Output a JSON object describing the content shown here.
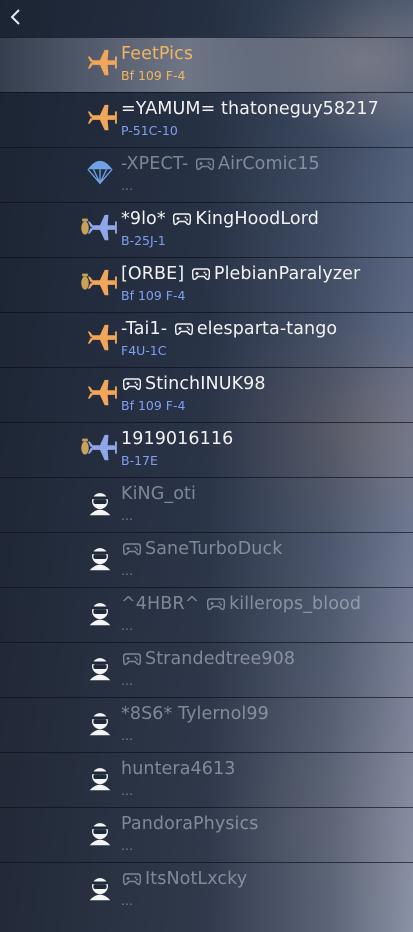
{
  "header": {
    "back_icon": "chevron-left-icon"
  },
  "colors": {
    "ally_plane": "#f2a65a",
    "bomber_plane": "#8fa6e8",
    "selected_text": "#f3b560",
    "vehicle_text": "#7fa0ee"
  },
  "players": [
    {
      "name": "FeetPics",
      "vehicle": "Bf 109 F-4",
      "icon": "fighter-plane-icon",
      "controller": false,
      "state": "selected"
    },
    {
      "name": "=YAMUM= thatoneguy58217",
      "vehicle": "P-51C-10",
      "icon": "fighter-plane-icon",
      "controller": false,
      "state": "active"
    },
    {
      "name": "-XPECT- ",
      "name_after": "AirComic15",
      "vehicle": "...",
      "icon": "parachute-icon",
      "controller": true,
      "state": "dim"
    },
    {
      "name": "*9lo* ",
      "name_after": "KingHoodLord",
      "vehicle": "B-25J-1",
      "icon": "bomber-plane-icon",
      "controller": true,
      "state": "active"
    },
    {
      "name": "[ORBE] ",
      "name_after": "PlebianParalyzer",
      "vehicle": "Bf 109 F-4",
      "icon": "fighter-bomber-plane-icon",
      "controller": true,
      "state": "active"
    },
    {
      "name": "-Tai1- ",
      "name_after": "elesparta-tango",
      "vehicle": "F4U-1C",
      "icon": "fighter-plane-icon",
      "controller": true,
      "state": "active"
    },
    {
      "name": "",
      "name_after": "StinchINUK98",
      "vehicle": "Bf 109 F-4",
      "icon": "fighter-plane-icon",
      "controller": true,
      "state": "active"
    },
    {
      "name": "1919016116",
      "vehicle": "B-17E",
      "icon": "bomber-plane-icon",
      "controller": false,
      "state": "active"
    },
    {
      "name": "KiNG_oti",
      "vehicle": "...",
      "icon": "pilot-icon",
      "controller": false,
      "state": "dim"
    },
    {
      "name": "",
      "name_after": "SaneTurboDuck",
      "vehicle": "...",
      "icon": "pilot-icon",
      "controller": true,
      "state": "dim"
    },
    {
      "name": "^4HBR^ ",
      "name_after": "killerops_blood",
      "vehicle": "...",
      "icon": "pilot-icon",
      "controller": true,
      "state": "dim"
    },
    {
      "name": "",
      "name_after": "Strandedtree908",
      "vehicle": "...",
      "icon": "pilot-icon",
      "controller": true,
      "state": "dim"
    },
    {
      "name": "*8S6* Tylernol99",
      "vehicle": "...",
      "icon": "pilot-icon",
      "controller": false,
      "state": "dim"
    },
    {
      "name": "huntera4613",
      "vehicle": "...",
      "icon": "pilot-icon",
      "controller": false,
      "state": "dim"
    },
    {
      "name": "PandoraPhysics",
      "vehicle": "...",
      "icon": "pilot-icon",
      "controller": false,
      "state": "dim"
    },
    {
      "name": "",
      "name_after": "ItsNotLxcky",
      "vehicle": "...",
      "icon": "pilot-icon",
      "controller": true,
      "state": "dim"
    }
  ]
}
